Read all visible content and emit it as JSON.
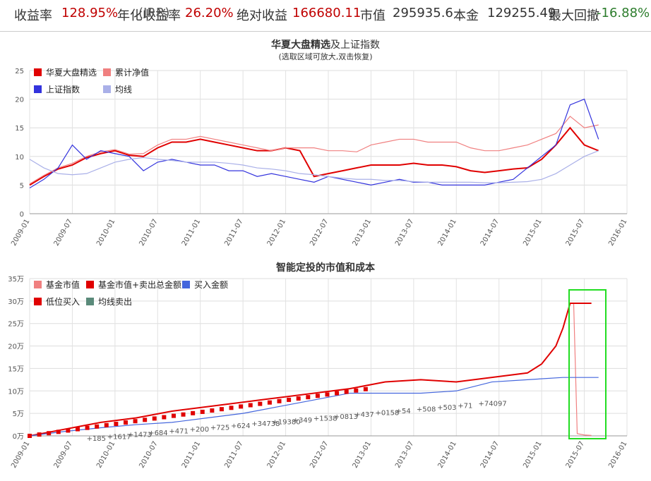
{
  "stats": {
    "return_label": "收益率",
    "return_value": "128.95%",
    "irr_label": "年化收益率",
    "irr_sub": "(IRR)",
    "irr_value": "26.20%",
    "abs_label": "绝对收益",
    "abs_value": "166680.11",
    "mv_label": "市值",
    "mv_value": "295935.6",
    "principal_label": "本金",
    "principal_value": "129255.49",
    "dd_label": "最大回撤",
    "dd_value": "-16.88%"
  },
  "colors": {
    "fund": "#e00000",
    "nav": "#f08080",
    "index": "#3333dd",
    "ma": "#aab0e8",
    "buy": "#4466dd",
    "highlight": "#22dd22"
  },
  "chart_data": [
    {
      "type": "line",
      "title": "华夏大盘精选及上证指数",
      "title_bold": "华夏大盘精选",
      "title_rest": "及上证指数",
      "subtitle": "(选取区域可放大,双击恢复)",
      "ylim": [
        0,
        25
      ],
      "yticks": [
        "0",
        "5",
        "10",
        "15",
        "20",
        "25"
      ],
      "xticks": [
        "2009-01",
        "2009-07",
        "2010-01",
        "2010-07",
        "2011-01",
        "2011-07",
        "2012-01",
        "2012-07",
        "2013-01",
        "2013-07",
        "2014-01",
        "2014-07",
        "2015-01",
        "2015-07",
        "2016-01"
      ],
      "legend": [
        "华夏大盘精选",
        "累计净值",
        "上证指数",
        "均线"
      ],
      "series": [
        {
          "name": "华夏大盘精选",
          "x": [
            0,
            2,
            4,
            6,
            8,
            10,
            12,
            14,
            16,
            18,
            20,
            22,
            24,
            26,
            28,
            30,
            32,
            34,
            36,
            38,
            40,
            42,
            44,
            46,
            48,
            50,
            52,
            54,
            56,
            58,
            60,
            62,
            64,
            66,
            68,
            70,
            72,
            74,
            76,
            78,
            80
          ],
          "values": [
            5,
            6.5,
            7.8,
            8.5,
            9.8,
            10.5,
            11,
            10.2,
            10,
            11.5,
            12.5,
            12.5,
            13,
            12.5,
            12,
            11.5,
            11,
            11,
            11.5,
            11,
            6.5,
            7,
            7.5,
            8,
            8.5,
            8.5,
            8.5,
            8.8,
            8.5,
            8.5,
            8.2,
            7.5,
            7.2,
            7.5,
            7.8,
            8,
            9.5,
            12,
            15,
            12,
            11
          ]
        },
        {
          "name": "累计净值",
          "x": [
            0,
            2,
            4,
            6,
            8,
            10,
            12,
            14,
            16,
            18,
            20,
            22,
            24,
            26,
            28,
            30,
            32,
            34,
            36,
            38,
            40,
            42,
            44,
            46,
            48,
            50,
            52,
            54,
            56,
            58,
            60,
            62,
            64,
            66,
            68,
            70,
            72,
            74,
            76,
            78,
            80
          ],
          "values": [
            5.2,
            6.7,
            8,
            8.8,
            10,
            10.8,
            11.2,
            10.4,
            10.5,
            12,
            13,
            13,
            13.5,
            13,
            12.5,
            12,
            11.5,
            11,
            11.5,
            11.5,
            11.5,
            11,
            11,
            10.8,
            12,
            12.5,
            13,
            13,
            12.5,
            12.5,
            12.5,
            11.5,
            11,
            11,
            11.5,
            12,
            13,
            14,
            17,
            15,
            15.5
          ]
        },
        {
          "name": "上证指数",
          "x": [
            0,
            2,
            4,
            6,
            8,
            10,
            12,
            14,
            16,
            18,
            20,
            22,
            24,
            26,
            28,
            30,
            32,
            34,
            36,
            38,
            40,
            42,
            44,
            46,
            48,
            50,
            52,
            54,
            56,
            58,
            60,
            62,
            64,
            66,
            68,
            70,
            72,
            74,
            76,
            78,
            80
          ],
          "values": [
            4.5,
            6,
            8,
            12,
            9.5,
            11,
            10.5,
            10,
            7.5,
            9,
            9.5,
            9,
            8.5,
            8.5,
            7.5,
            7.5,
            6.5,
            7,
            6.5,
            6,
            5.5,
            6.5,
            6,
            5.5,
            5,
            5.5,
            6,
            5.5,
            5.5,
            5,
            5,
            5,
            5,
            5.5,
            6,
            8,
            10,
            12,
            19,
            20,
            13
          ]
        },
        {
          "name": "均线",
          "x": [
            0,
            2,
            4,
            6,
            8,
            10,
            12,
            14,
            16,
            18,
            20,
            22,
            24,
            26,
            28,
            30,
            32,
            34,
            36,
            38,
            40,
            42,
            44,
            46,
            48,
            50,
            52,
            54,
            56,
            58,
            60,
            62,
            64,
            66,
            68,
            70,
            72,
            74,
            76,
            78,
            80
          ],
          "values": [
            9.5,
            8,
            7,
            6.8,
            7,
            8,
            9,
            9.5,
            9.8,
            9.5,
            9.3,
            9,
            9,
            9,
            8.8,
            8.5,
            8,
            7.8,
            7.5,
            7,
            6.8,
            6.5,
            6.2,
            6,
            6,
            5.8,
            5.8,
            5.6,
            5.5,
            5.5,
            5.5,
            5.5,
            5.4,
            5.4,
            5.5,
            5.6,
            6,
            7,
            8.5,
            10,
            11
          ]
        }
      ]
    },
    {
      "type": "line",
      "title": "智能定投的市值和成本",
      "ylim": [
        0,
        35
      ],
      "yticks": [
        "0万",
        "5万",
        "10万",
        "15万",
        "20万",
        "25万",
        "30万",
        "35万"
      ],
      "xticks": [
        "2009-01",
        "2009-07",
        "2010-01",
        "2010-07",
        "2011-01",
        "2011-07",
        "2012-01",
        "2012-07",
        "2013-01",
        "2013-07",
        "2014-01",
        "2014-07",
        "2015-01",
        "2015-07",
        "2016-01"
      ],
      "legend": [
        "基金市值",
        "基金市值+卖出总金额",
        "买入金额",
        "低位买入",
        "均线卖出"
      ],
      "annotations": [
        "+185",
        "+1617",
        "+1473",
        "+684",
        "+471",
        "+200",
        "+725",
        "+624",
        "+34738",
        "+19380",
        "+349",
        "+1538",
        "+0813",
        "+437",
        "+0158",
        "+54",
        "+508",
        "+503",
        "+71",
        "+74097"
      ],
      "series": [
        {
          "name": "基金市值",
          "x": [
            0,
            5,
            10,
            15,
            20,
            25,
            30,
            35,
            40,
            45,
            50,
            55,
            60,
            65,
            70,
            72,
            74,
            75,
            76,
            76.5,
            77,
            78,
            79
          ],
          "values": [
            0,
            1.5,
            3,
            4,
            5.5,
            6.5,
            7.5,
            8.5,
            9.5,
            10.5,
            12,
            12.5,
            12,
            13,
            14,
            16,
            20,
            24,
            29.5,
            29.5,
            0.5,
            0.2,
            0.1
          ]
        },
        {
          "name": "基金市值+卖出总金额",
          "x": [
            0,
            5,
            10,
            15,
            20,
            25,
            30,
            35,
            40,
            45,
            50,
            55,
            60,
            65,
            70,
            72,
            74,
            75,
            76,
            77,
            78,
            79
          ],
          "values": [
            0,
            1.5,
            3,
            4,
            5.5,
            6.5,
            7.5,
            8.5,
            9.5,
            10.5,
            12,
            12.5,
            12,
            13,
            14,
            16,
            20,
            24,
            29.5,
            29.5,
            29.5,
            29.5
          ]
        },
        {
          "name": "买入金额",
          "x": [
            0,
            5,
            10,
            15,
            20,
            25,
            30,
            35,
            40,
            45,
            50,
            55,
            60,
            65,
            70,
            75,
            80
          ],
          "values": [
            0,
            1,
            1.8,
            2.5,
            3,
            4,
            5,
            6.5,
            8,
            9.5,
            9.5,
            9.5,
            10,
            12,
            12.5,
            13,
            13
          ]
        }
      ]
    }
  ]
}
